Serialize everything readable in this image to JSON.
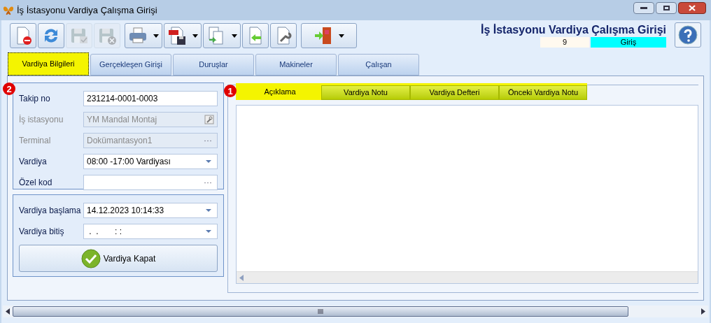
{
  "window": {
    "title": "İş İstasyonu Vardiya Çalışma Girişi"
  },
  "toolbar": [
    {
      "kind": "new-delete",
      "disabled": false,
      "dropdown": false
    },
    {
      "kind": "refresh",
      "disabled": false,
      "dropdown": false
    },
    {
      "kind": "save-check",
      "disabled": true,
      "dropdown": false
    },
    {
      "kind": "save-cancel",
      "disabled": true,
      "dropdown": false
    },
    {
      "kind": "print",
      "disabled": false,
      "dropdown": true
    },
    {
      "kind": "pdf-save",
      "disabled": false,
      "dropdown": true
    },
    {
      "kind": "copy",
      "disabled": false,
      "dropdown": true
    },
    {
      "kind": "import",
      "disabled": false,
      "dropdown": false
    },
    {
      "kind": "settings",
      "disabled": false,
      "dropdown": false
    },
    {
      "kind": "exit",
      "disabled": false,
      "dropdown": true
    }
  ],
  "header": {
    "title": "İş İstasyonu Vardiya Çalışma Girişi",
    "number": "9",
    "mode": "Giriş"
  },
  "tabs": [
    {
      "label": "Vardiya Bilgileri",
      "selected": true
    },
    {
      "label": "Gerçekleşen Girişi",
      "selected": false
    },
    {
      "label": "Duruşlar",
      "selected": false
    },
    {
      "label": "Makineler",
      "selected": false
    },
    {
      "label": "Çalışan",
      "selected": false
    }
  ],
  "badges": [
    "2",
    "1"
  ],
  "group_1": [
    {
      "label": "Takip no",
      "value": "231214-0001-0003",
      "kind": "text",
      "disabled": false
    },
    {
      "label": "İş istasyonu",
      "value": "YM Mandal Montaj",
      "kind": "lookup",
      "disabled": true
    },
    {
      "label": "Terminal",
      "value": "Dokümantasyon1",
      "kind": "ellipsis",
      "disabled": true
    },
    {
      "label": "Vardiya",
      "value": "08:00 -17:00 Vardiyası",
      "kind": "dropdown",
      "disabled": false
    },
    {
      "label": "Özel kod",
      "kind": "ellipsis",
      "disabled": false
    }
  ],
  "group_2": [
    {
      "label": "Vardiya başlama",
      "value": "14.12.2023 10:14:33",
      "kind": "dropdown",
      "disabled": false
    },
    {
      "label": "Vardiya bitiş",
      "value": " .  .       : :",
      "kind": "dropdown",
      "disabled": false
    }
  ],
  "close_button": "Vardiya Kapat",
  "inner_tabs": [
    {
      "label": "Açıklama",
      "selected": true
    },
    {
      "label": "Vardiya Notu",
      "selected": false
    },
    {
      "label": "Vardiya Defteri",
      "selected": false
    },
    {
      "label": "Önceki Vardiya Notu",
      "selected": false
    }
  ]
}
